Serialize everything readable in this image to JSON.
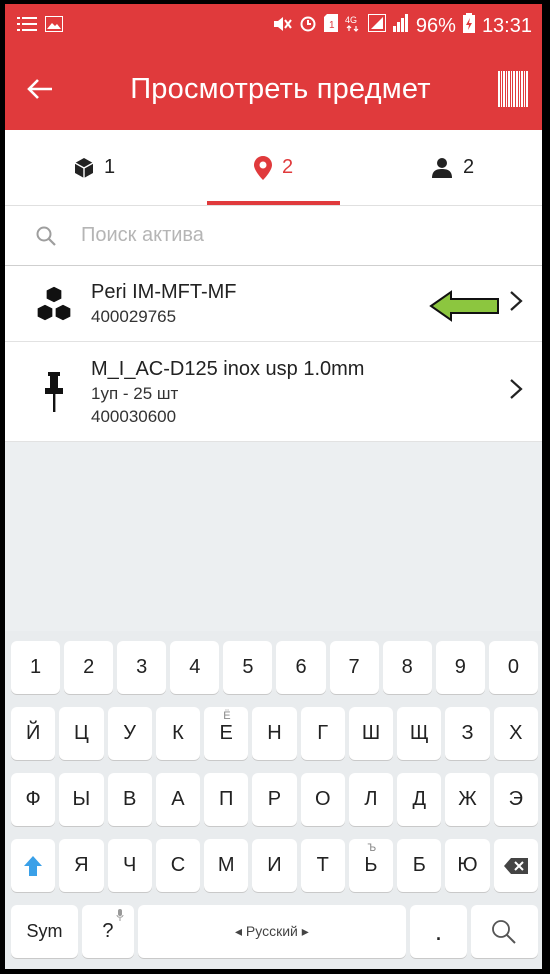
{
  "status_bar": {
    "battery": "96%",
    "time": "13:31"
  },
  "app_bar": {
    "title": "Просмотреть предмет"
  },
  "tabs": [
    {
      "icon": "cube-icon",
      "count": "1"
    },
    {
      "icon": "location-pin-icon",
      "count": "2"
    },
    {
      "icon": "person-icon",
      "count": "2"
    }
  ],
  "search": {
    "placeholder": "Поиск актива"
  },
  "items": [
    {
      "icon": "cubes-icon",
      "title": "Peri IM-MFT-MF",
      "line2": "400029765"
    },
    {
      "icon": "pushpin-icon",
      "title": "M_I_AC-D125 inox usp 1.0mm",
      "line2": "1уп - 25 шт",
      "line3": "400030600"
    }
  ],
  "keyboard": {
    "row1": [
      "1",
      "2",
      "3",
      "4",
      "5",
      "6",
      "7",
      "8",
      "9",
      "0"
    ],
    "row2": [
      "Й",
      "Ц",
      "У",
      "К",
      "Е",
      "Н",
      "Г",
      "Ш",
      "Щ",
      "З",
      "Х"
    ],
    "row2_hint": "Ё",
    "row3": [
      "Ф",
      "Ы",
      "В",
      "А",
      "П",
      "Р",
      "О",
      "Л",
      "Д",
      "Ж",
      "Э"
    ],
    "row4": [
      "Я",
      "Ч",
      "С",
      "М",
      "И",
      "Т",
      "Ь",
      "Б",
      "Ю"
    ],
    "row4_hint": "Ъ",
    "sym_label": "Sym",
    "question": "?",
    "space_label": "◂ Русский ▸",
    "dot": "."
  }
}
